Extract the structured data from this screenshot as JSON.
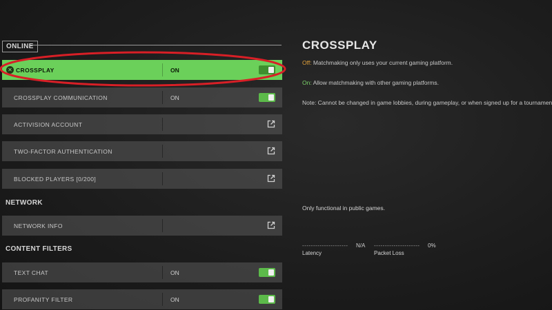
{
  "sections": {
    "online": "ONLINE",
    "network": "NETWORK",
    "content_filters": "CONTENT FILTERS"
  },
  "rows": [
    {
      "label": "CROSSPLAY",
      "value": "ON",
      "control": "toggle"
    },
    {
      "label": "CROSSPLAY COMMUNICATION",
      "value": "ON",
      "control": "toggle"
    },
    {
      "label": "ACTIVISION ACCOUNT",
      "value": "",
      "control": "external-link-icon"
    },
    {
      "label": "TWO-FACTOR AUTHENTICATION",
      "value": "",
      "control": "external-link-icon"
    },
    {
      "label": "BLOCKED PLAYERS [0/200]",
      "value": "",
      "control": "external-link-icon"
    },
    {
      "label": "NETWORK INFO",
      "value": "",
      "control": "external-link-icon"
    },
    {
      "label": "TEXT CHAT",
      "value": "ON",
      "control": "toggle"
    },
    {
      "label": "PROFANITY FILTER",
      "value": "ON",
      "control": "toggle"
    }
  ],
  "detail": {
    "title": "CROSSPLAY",
    "off_key": "Off:",
    "off_text": " Matchmaking only uses your current gaming platform.",
    "on_key": "On:",
    "on_text": " Allow matchmaking with other gaming platforms.",
    "note": "Note: Cannot be changed in game lobbies, during gameplay, or when signed up for a tournament.",
    "public_note": "Only functional in public games.",
    "latency_label": "Latency",
    "latency_value": "N/A",
    "packet_loss_label": "Packet Loss",
    "packet_loss_value": "0%",
    "dashes": "---------------------"
  },
  "colors": {
    "selected_row": "#6bd05a",
    "toggle_on": "#5cba4a",
    "annotation_circle": "#d81f26",
    "off_key": "#e2a13a",
    "on_key": "#7cd46a"
  }
}
